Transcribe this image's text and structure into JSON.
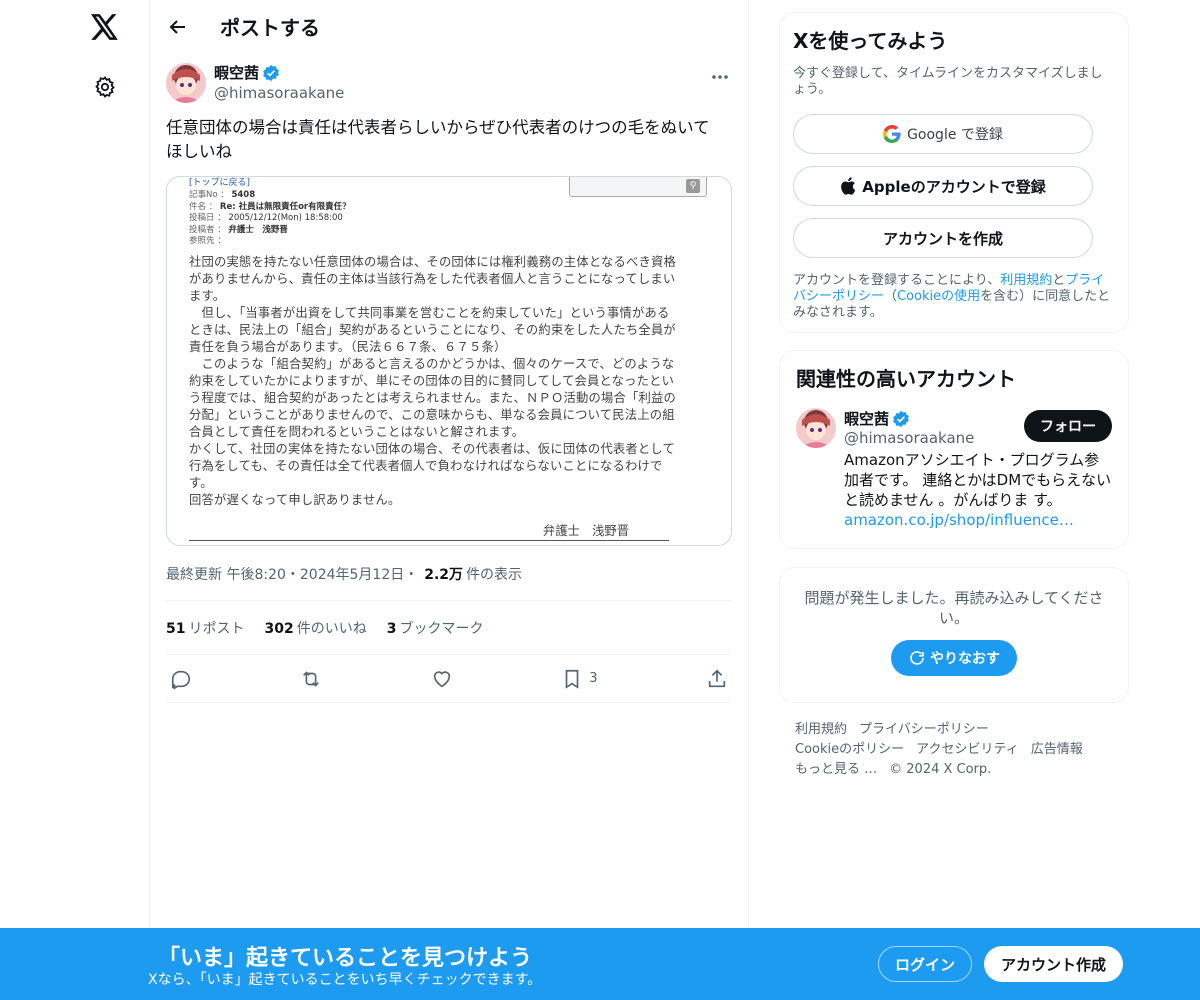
{
  "header": {
    "title": "ポストする"
  },
  "post": {
    "author_name": "暇空茜",
    "author_handle": "@himasoraakane",
    "text": "任意団体の場合は責任は代表者らしいからぜひ代表者のけつの毛をぬいて\nほしいね",
    "image": {
      "top_link": "[トップに戻る]",
      "meta": [
        {
          "k": "記事No ：",
          "v": "5408"
        },
        {
          "k": "件名 ：",
          "v": "Re: 社員は無限責任or有限責任？"
        },
        {
          "k": "投稿日 ：",
          "v": "2005/12/12(Mon) 18:58:00"
        },
        {
          "k": "投稿者 ：",
          "v": "弁護士　浅野晋"
        },
        {
          "k": "参照先 ：",
          "v": ""
        }
      ],
      "body": "社団の実態を持たない任意団体の場合は、その団体には権利義務の主体となるべき資格\nがありませんから、責任の主体は当該行為をした代表者個人と言うことになってしまい\nます。\n　但し、「当事者が出資をして共同事業を営むことを約束していた」という事情がある\nときは、民法上の「組合」契約があるということになり、その約束をした人たち全員が\n責任を負う場合があります。（民法６６７条、６７５条）\n　このような「組合契約」があると言えるのかどうかは、個々のケースで、どのような\n約束をしていたかによりますが、単にその団体の目的に賛同してして会員となったとい\nう程度では、組合契約があったとは考えられません。また、ＮＰＯ活動の場合「利益の\n分配」ということがありませんので、この意味からも、単なる会員について民法上の組\n合員として責任を問われるということはないと解されます。\nかくして、社団の実体を持たない団体の場合、その代表者は、仮に団体の代表者として\n行為をしても、その責任は全て代表者個人で負わなければならないことになるわけで\nす。\n回答が遅くなって申し訳ありません。",
      "signature": "弁護士　浅野晋"
    },
    "meta_prefix": "最終更新 午後8:20・2024年5月12日・",
    "views_count": "2.2万",
    "views_label": "件の表示",
    "reposts_count": "51",
    "reposts_label": "リポスト",
    "likes_count": "302",
    "likes_label": "件のいいね",
    "bookmarks_count": "3",
    "bookmarks_label": "ブックマーク",
    "bookmark_action_count": "3"
  },
  "signup": {
    "title": "Xを使ってみよう",
    "subtitle": "今すぐ登録して、タイムラインをカスタマイズしましょう。",
    "google_label": "Google で登録",
    "apple_label": "Appleのアカウントで登録",
    "create_label": "アカウントを作成",
    "legal_1": "アカウントを登録することにより、",
    "legal_terms": "利用規約",
    "legal_and": "と",
    "legal_privacy": "プライバシーポリシー",
    "legal_2": "（",
    "legal_cookie": "Cookieの使用",
    "legal_3": "を含む）に同意したとみなされます。"
  },
  "related": {
    "title": "関連性の高いアカウント",
    "name": "暇空茜",
    "handle": "@himasoraakane",
    "follow_label": "フォロー",
    "bio": "Amazonアソシエイト・プログラム参加者です。 連絡とかはDMでもらえないと読めません 。がんばりま す。",
    "bio_link": "amazon.co.jp/shop/influence…"
  },
  "error": {
    "text": "問題が発生しました。再読み込みしてください。",
    "retry_label": "やりなおす"
  },
  "footer": {
    "terms": "利用規約",
    "privacy": "プライバシーポリシー",
    "cookie": "Cookieのポリシー",
    "accessibility": "アクセシビリティ",
    "ads": "広告情報",
    "more": "もっと見る …",
    "copyright": "© 2024 X Corp."
  },
  "bottom_bar": {
    "title": "「いま」起きていることを見つけよう",
    "subtitle": "Xなら、「いま」起きていることをいち早くチェックできます。",
    "login_label": "ログイン",
    "create_label": "アカウント作成"
  },
  "colors": {
    "accent": "#1d9bf0",
    "text": "#0f1419",
    "muted": "#536471",
    "border": "#eff3f4"
  }
}
